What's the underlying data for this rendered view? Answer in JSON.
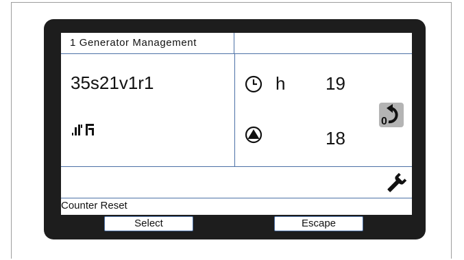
{
  "header": {
    "title": "1 Generator Management"
  },
  "left_panel": {
    "identifier": "35s21v1r1",
    "status_icon": "signal-relay-icon"
  },
  "right_panel": {
    "hours_icon": "clock-icon",
    "hours_unit": "h",
    "hours_value": "19",
    "pump_icon": "pump-icon",
    "pump_value": "18",
    "reset_icon": "counter-reset-icon",
    "reset_icon_text": "0"
  },
  "tool_icon": "wrench-icon",
  "status": {
    "text": "Counter Reset"
  },
  "softkeys": {
    "select_label": "Select",
    "escape_label": "Escape"
  },
  "colors": {
    "bezel": "#1d1d1d",
    "lcd_background": "#ffffff",
    "divider": "#4a6fa5"
  }
}
